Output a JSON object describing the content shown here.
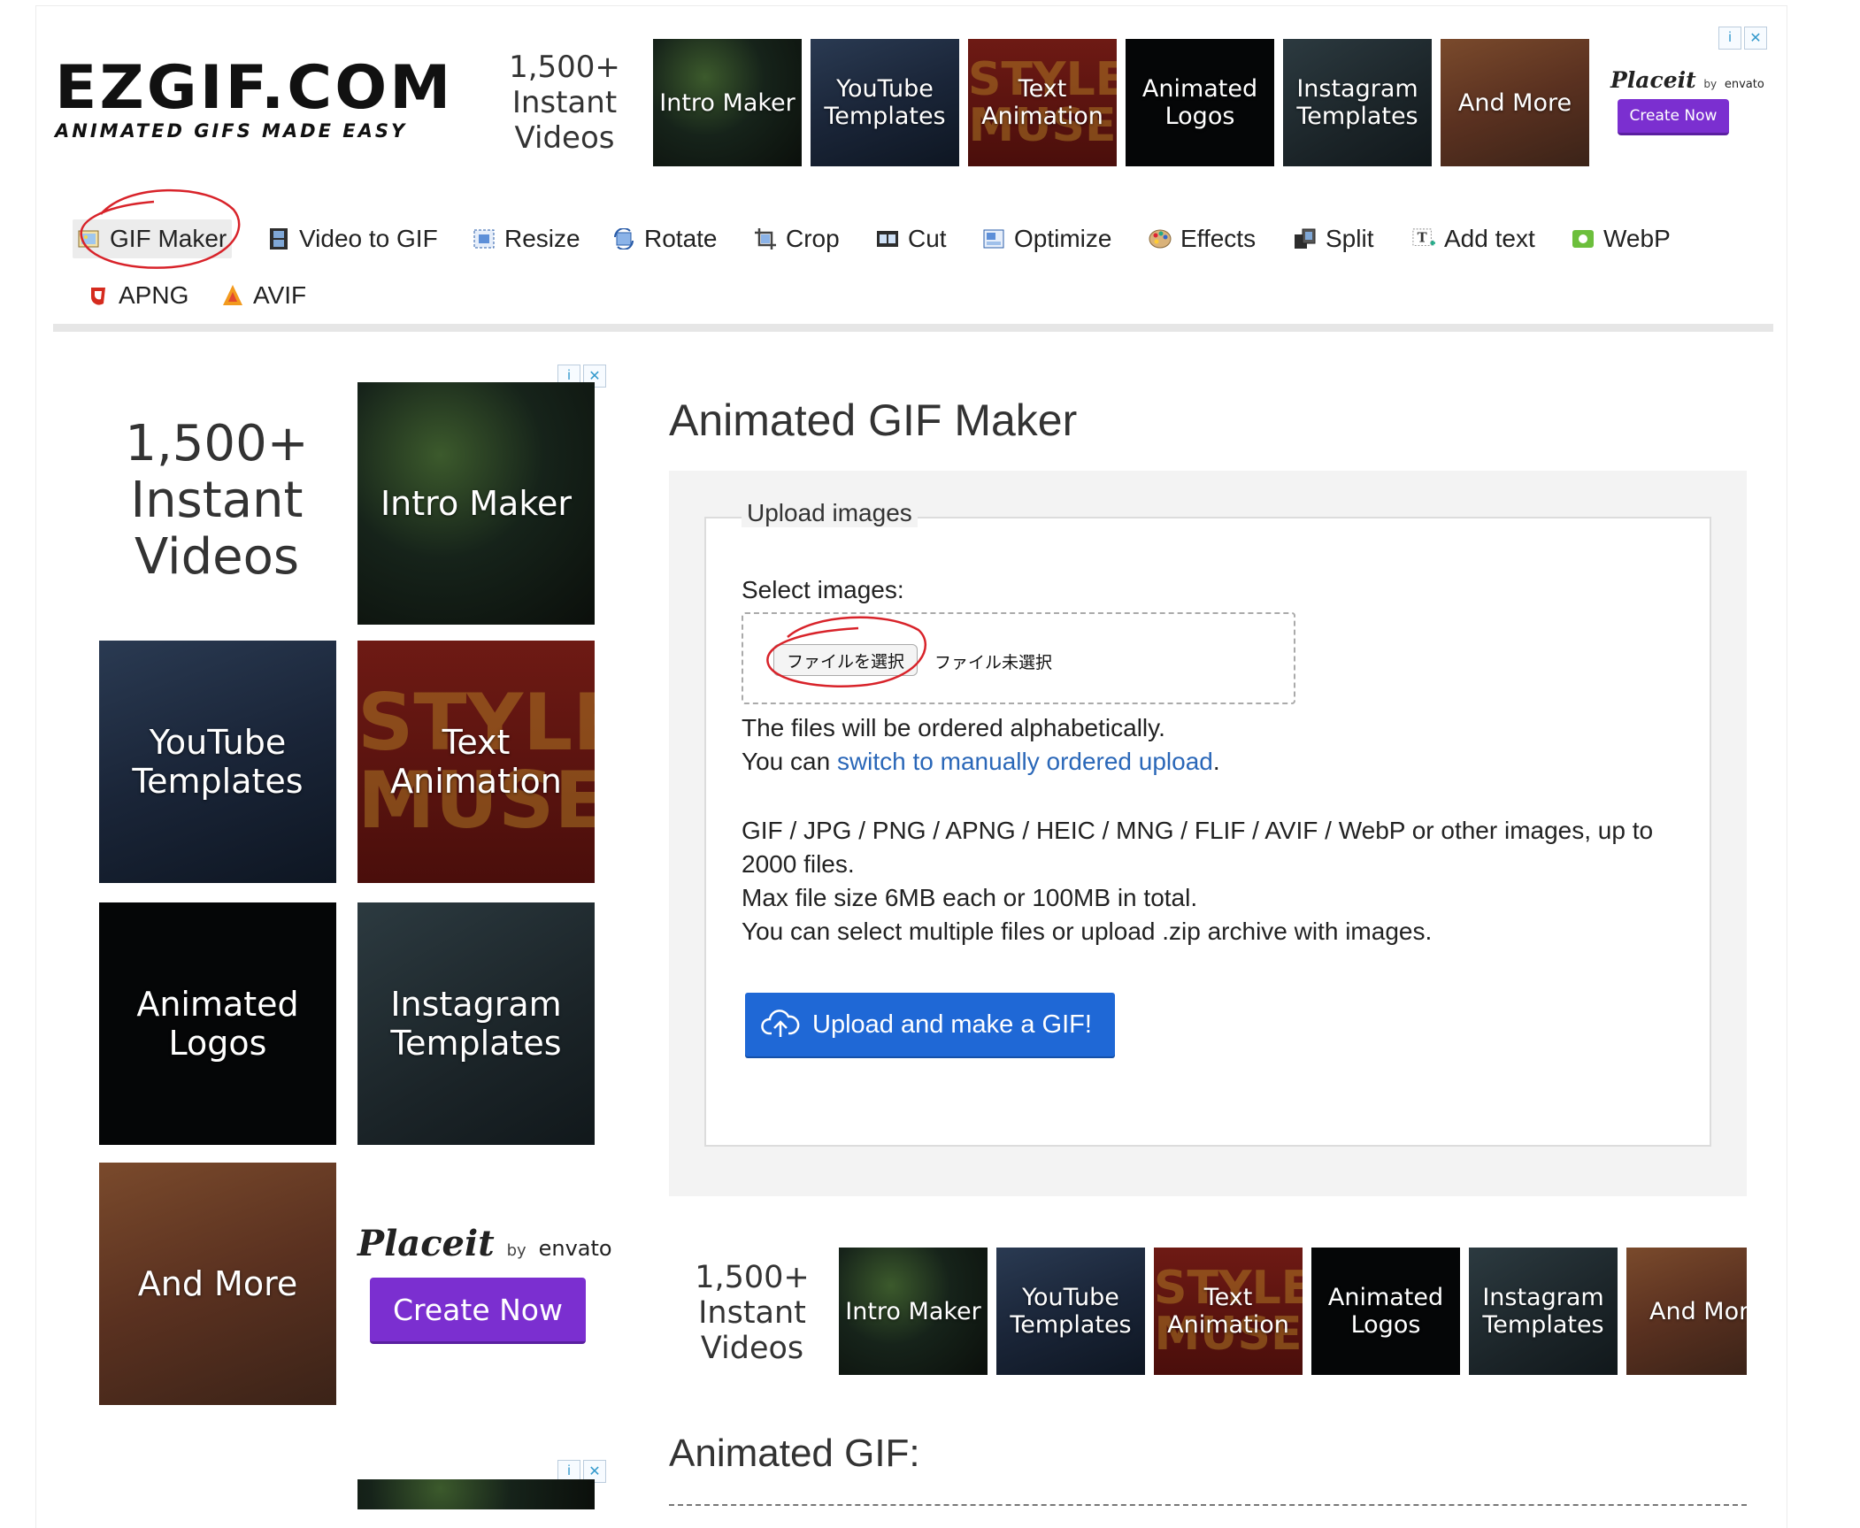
{
  "logo": {
    "main": "EZGIF.COM",
    "tagline": "ANIMATED GIFS MADE EASY"
  },
  "ad": {
    "promo_line1": "1,500+",
    "promo_line2": "Instant",
    "promo_line3": "Videos",
    "tiles": {
      "intro": "Intro Maker",
      "youtube_1": "YouTube",
      "youtube_2": "Templates",
      "text_1": "Text",
      "text_2": "Animation",
      "text_full": "Text Animation",
      "style": "STYLE",
      "muse": "MUSE",
      "logos_1": "Animated",
      "logos_2": "Logos",
      "insta_1": "Instagram",
      "insta_2": "Templates",
      "more": "And More",
      "more_cut": "And Mor"
    },
    "brand": "Placeit",
    "brand_by": "by",
    "brand_envato": "envato",
    "cta": "Create Now",
    "adchoice_info": "i",
    "adchoice_close": "✕"
  },
  "nav": {
    "items": [
      {
        "label": "GIF Maker",
        "icon": "gif-maker-icon",
        "active": true
      },
      {
        "label": "Video to GIF",
        "icon": "film-icon"
      },
      {
        "label": "Resize",
        "icon": "resize-icon"
      },
      {
        "label": "Rotate",
        "icon": "rotate-icon"
      },
      {
        "label": "Crop",
        "icon": "crop-icon"
      },
      {
        "label": "Cut",
        "icon": "cut-icon"
      },
      {
        "label": "Optimize",
        "icon": "optimize-icon"
      },
      {
        "label": "Effects",
        "icon": "palette-icon"
      },
      {
        "label": "Split",
        "icon": "split-icon"
      },
      {
        "label": "Add text",
        "icon": "add-text-icon"
      },
      {
        "label": "WebP",
        "icon": "webp-icon"
      },
      {
        "label": "APNG",
        "icon": "apng-icon"
      },
      {
        "label": "AVIF",
        "icon": "avif-icon"
      }
    ]
  },
  "main": {
    "title": "Animated GIF Maker",
    "fieldset_legend": "Upload images",
    "select_label": "Select images:",
    "file_button": "ファイルを選択",
    "file_status": "ファイル未選択",
    "order_note": "The files will be ordered alphabetically.",
    "switch_prefix": "You can ",
    "switch_link": "switch to manually ordered upload",
    "switch_suffix": ".",
    "formats_1": "GIF / JPG / PNG / APNG / HEIC / MNG / FLIF / AVIF / WebP or other images, up to",
    "formats_2": "2000 files.",
    "max_size": "Max file size 6MB each or 100MB in total.",
    "multi": "You can select multiple files or upload .zip archive with images.",
    "upload_button": "Upload and make a GIF!",
    "result_title": "Animated GIF:"
  },
  "colors": {
    "accent_blue": "#1f68d6",
    "link_blue": "#2a67b8",
    "cta_purple": "#7b2fd0",
    "annotation_red": "#d8232a"
  }
}
